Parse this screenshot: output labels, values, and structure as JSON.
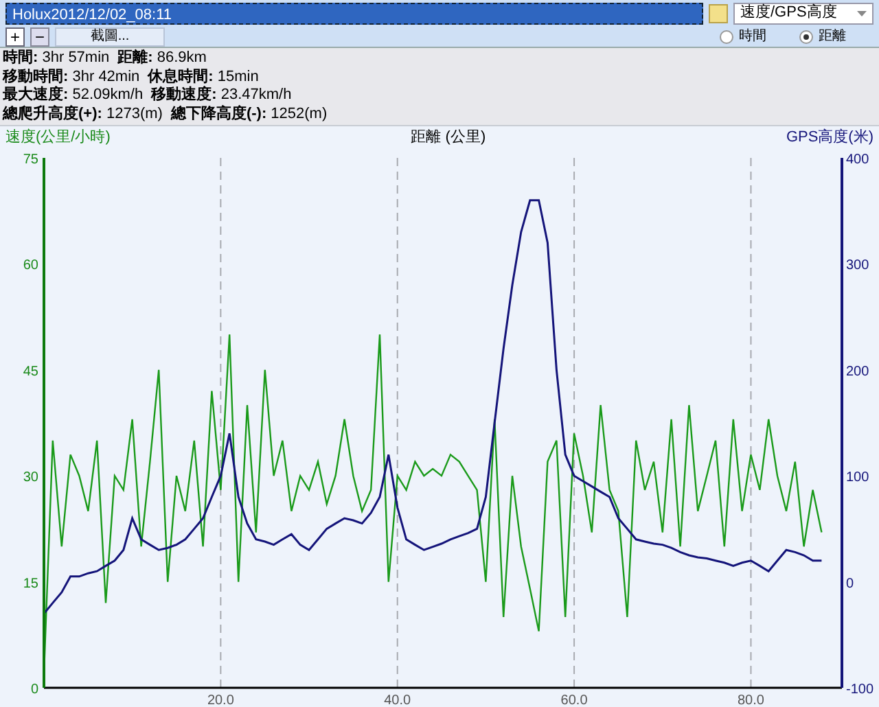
{
  "track_field": {
    "value": "Holux2012/12/02_08:11"
  },
  "chart_type_dropdown": {
    "value": "速度/GPS高度"
  },
  "toolbar": {
    "zoom_in": "+",
    "zoom_out": "−",
    "screenshot_button": "截圖..."
  },
  "axis_mode": [
    {
      "label": "時間",
      "selected": false
    },
    {
      "label": "距離",
      "selected": true
    }
  ],
  "stats": [
    [
      {
        "label": "時間:",
        "value": "3hr 57min"
      },
      {
        "label": "距離:",
        "value": "86.9km"
      }
    ],
    [
      {
        "label": "移動時間:",
        "value": "3hr 42min"
      },
      {
        "label": "休息時間:",
        "value": "15min"
      }
    ],
    [
      {
        "label": "最大速度:",
        "value": "52.09km/h"
      },
      {
        "label": "移動速度:",
        "value": "23.47km/h"
      }
    ],
    [
      {
        "label": "總爬升高度(+):",
        "value": "1273(m)"
      },
      {
        "label": "總下降高度(-):",
        "value": "1252(m)"
      }
    ]
  ],
  "chart_data": {
    "type": "line",
    "xlabel": "距離 (公里)",
    "ylabel": "速度(公里/小時)",
    "y2label": "GPS高度(米)",
    "grid": true,
    "x": [
      0,
      1,
      2,
      3,
      4,
      5,
      6,
      7,
      8,
      9,
      10,
      11,
      12,
      13,
      14,
      15,
      16,
      17,
      18,
      19,
      20,
      21,
      22,
      23,
      24,
      25,
      26,
      27,
      28,
      29,
      30,
      31,
      32,
      33,
      34,
      35,
      36,
      37,
      38,
      39,
      40,
      41,
      42,
      43,
      44,
      45,
      46,
      47,
      48,
      49,
      50,
      51,
      52,
      53,
      54,
      55,
      56,
      57,
      58,
      59,
      60,
      61,
      62,
      63,
      64,
      65,
      66,
      67,
      68,
      69,
      70,
      71,
      72,
      73,
      74,
      75,
      76,
      77,
      78,
      79,
      80,
      81,
      82,
      83,
      84,
      85,
      86,
      87,
      88
    ],
    "xlim": [
      0,
      90.3
    ],
    "ylim": [
      0,
      75
    ],
    "y2lim": [
      -100,
      400
    ],
    "xticks": [
      {
        "value": 20,
        "label": "20.0"
      },
      {
        "value": 40,
        "label": "40.0"
      },
      {
        "value": 60,
        "label": "60.0"
      },
      {
        "value": 80,
        "label": "80.0"
      }
    ],
    "yticks": [
      0,
      15,
      30,
      45,
      60,
      75
    ],
    "y2ticks": [
      -100,
      0,
      100,
      200,
      300,
      400
    ],
    "series": [
      {
        "color": "#1a9a1a",
        "values": [
          2,
          35,
          20,
          33,
          30,
          25,
          35,
          12,
          30,
          28,
          38,
          20,
          32,
          45,
          15,
          30,
          25,
          35,
          20,
          42,
          28,
          50,
          15,
          40,
          22,
          45,
          30,
          35,
          25,
          30,
          28,
          32,
          26,
          30,
          38,
          30,
          25,
          28,
          50,
          15,
          30,
          28,
          32,
          30,
          31,
          30,
          33,
          32,
          30,
          28,
          15,
          38,
          10,
          30,
          20,
          14,
          8,
          32,
          35,
          10,
          36,
          30,
          22,
          40,
          28,
          25,
          10,
          35,
          28,
          32,
          22,
          38,
          20,
          40,
          25,
          30,
          35,
          20,
          38,
          25,
          33,
          28,
          38,
          30,
          25,
          32,
          20,
          28,
          22
        ]
      },
      {
        "color": "#14147a",
        "axis": "y2",
        "values": [
          -30,
          -20,
          -10,
          5,
          5,
          8,
          10,
          15,
          20,
          30,
          60,
          40,
          35,
          30,
          32,
          35,
          40,
          50,
          60,
          80,
          100,
          140,
          80,
          55,
          40,
          38,
          35,
          40,
          45,
          35,
          30,
          40,
          50,
          55,
          60,
          58,
          55,
          65,
          80,
          120,
          70,
          40,
          35,
          30,
          33,
          36,
          40,
          43,
          46,
          50,
          80,
          150,
          220,
          280,
          330,
          360,
          360,
          320,
          200,
          120,
          100,
          95,
          90,
          85,
          80,
          60,
          50,
          40,
          38,
          36,
          35,
          32,
          28,
          25,
          23,
          22,
          20,
          18,
          15,
          18,
          20,
          15,
          10,
          20,
          30,
          28,
          25,
          20,
          20
        ]
      }
    ]
  }
}
